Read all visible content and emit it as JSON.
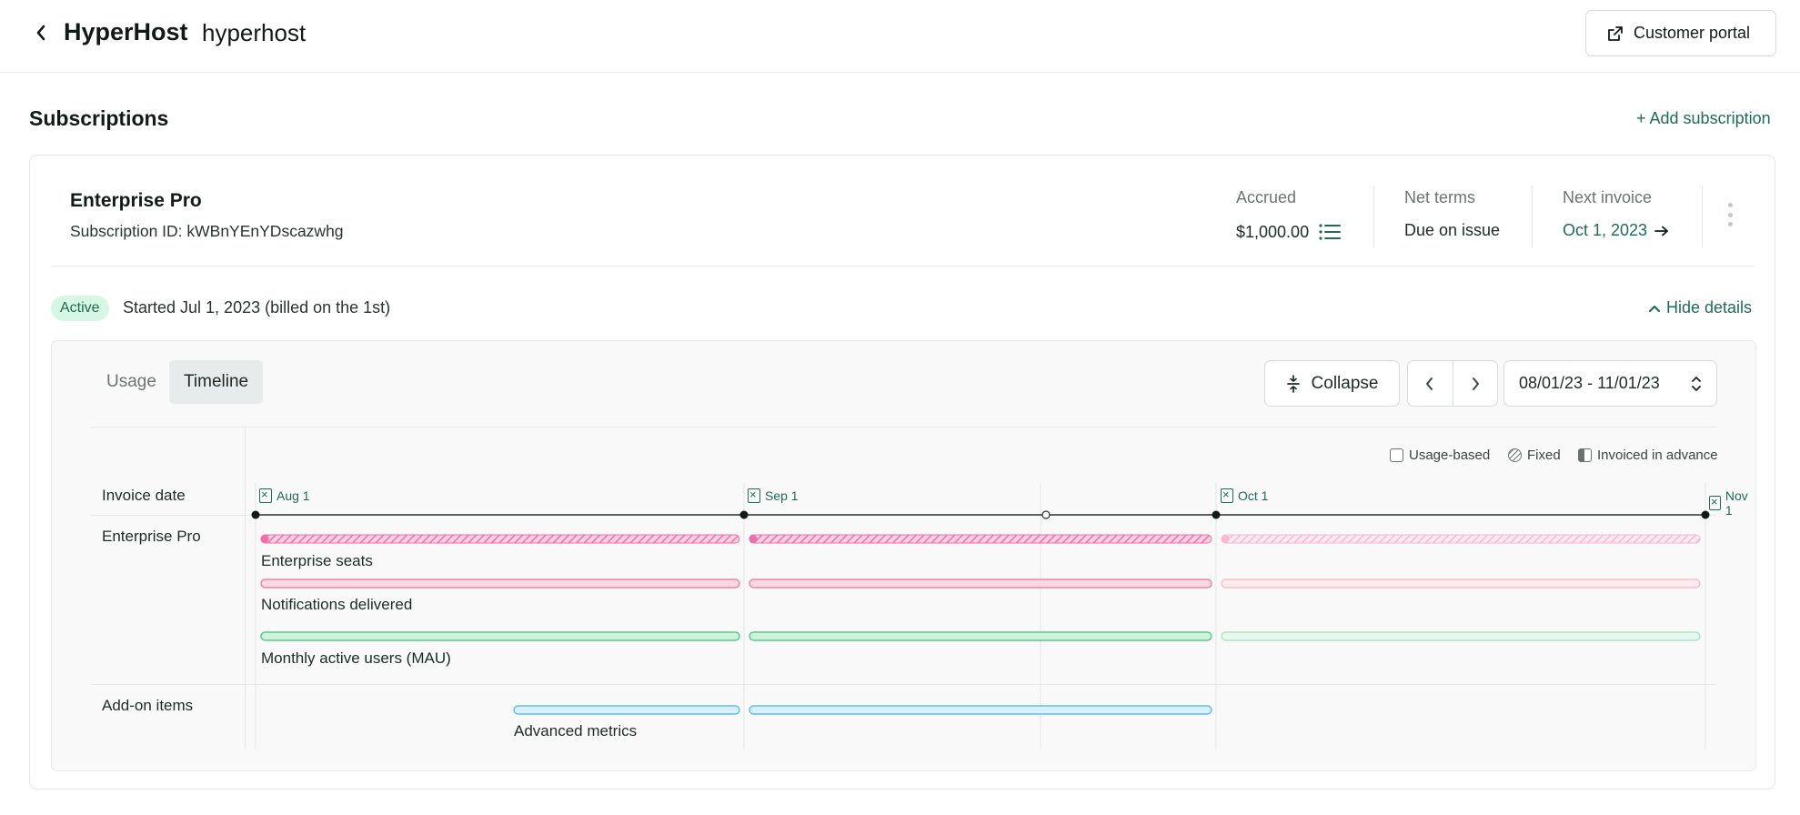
{
  "header": {
    "brand": "HyperHost",
    "org_name": "hyperhost",
    "portal_button": "Customer portal"
  },
  "subscriptions": {
    "title": "Subscriptions",
    "add_link": "+ Add subscription"
  },
  "subscription": {
    "plan_name": "Enterprise Pro",
    "subscription_id": "Subscription ID: kWBnYEnYDscazwhg",
    "accrued_label": "Accrued",
    "accrued_value": "$1,000.00",
    "net_terms_label": "Net terms",
    "net_terms_value": "Due on issue",
    "next_invoice_label": "Next invoice",
    "next_invoice_value": "Oct 1, 2023",
    "status": "Active",
    "started_text": "Started Jul 1, 2023 (billed on the 1st)",
    "hide_details": "Hide details"
  },
  "details": {
    "tabs": [
      {
        "label": "Usage",
        "active": false
      },
      {
        "label": "Timeline",
        "active": true
      }
    ],
    "collapse_button": "Collapse",
    "date_range": "08/01/23 - 11/01/23",
    "legend": [
      {
        "label": "Usage-based",
        "swatch": "usage"
      },
      {
        "label": "Fixed",
        "swatch": "fixed"
      },
      {
        "label": "Invoiced in advance",
        "swatch": "advance"
      }
    ],
    "row_labels": {
      "invoice_date": "Invoice date",
      "plan": "Enterprise Pro",
      "addons": "Add-on items"
    },
    "invoice_dates": [
      "Aug 1",
      "Sep 1",
      "Oct 1",
      "Nov 1"
    ],
    "line_items": [
      {
        "label": "Enterprise seats",
        "type": "fixed"
      },
      {
        "label": "Notifications delivered",
        "type": "usage"
      },
      {
        "label": "Monthly active users (MAU)",
        "type": "usage"
      },
      {
        "label": "Advanced metrics",
        "type": "addon"
      }
    ]
  },
  "colors": {
    "accent": "#1e6b5a",
    "seats": "#f06fa6",
    "notifications": "#f28aa3",
    "mau": "#4ccf86",
    "addon": "#5cbde8",
    "badge_bg": "#d6f7e4"
  },
  "icons": [
    "chevron-left-icon",
    "external-link-icon",
    "list-icon",
    "arrow-right-icon",
    "kebab-icon",
    "chevron-up-icon",
    "collapse-icon",
    "chevron-right-icon",
    "select-arrows-icon",
    "invoice-icon"
  ]
}
